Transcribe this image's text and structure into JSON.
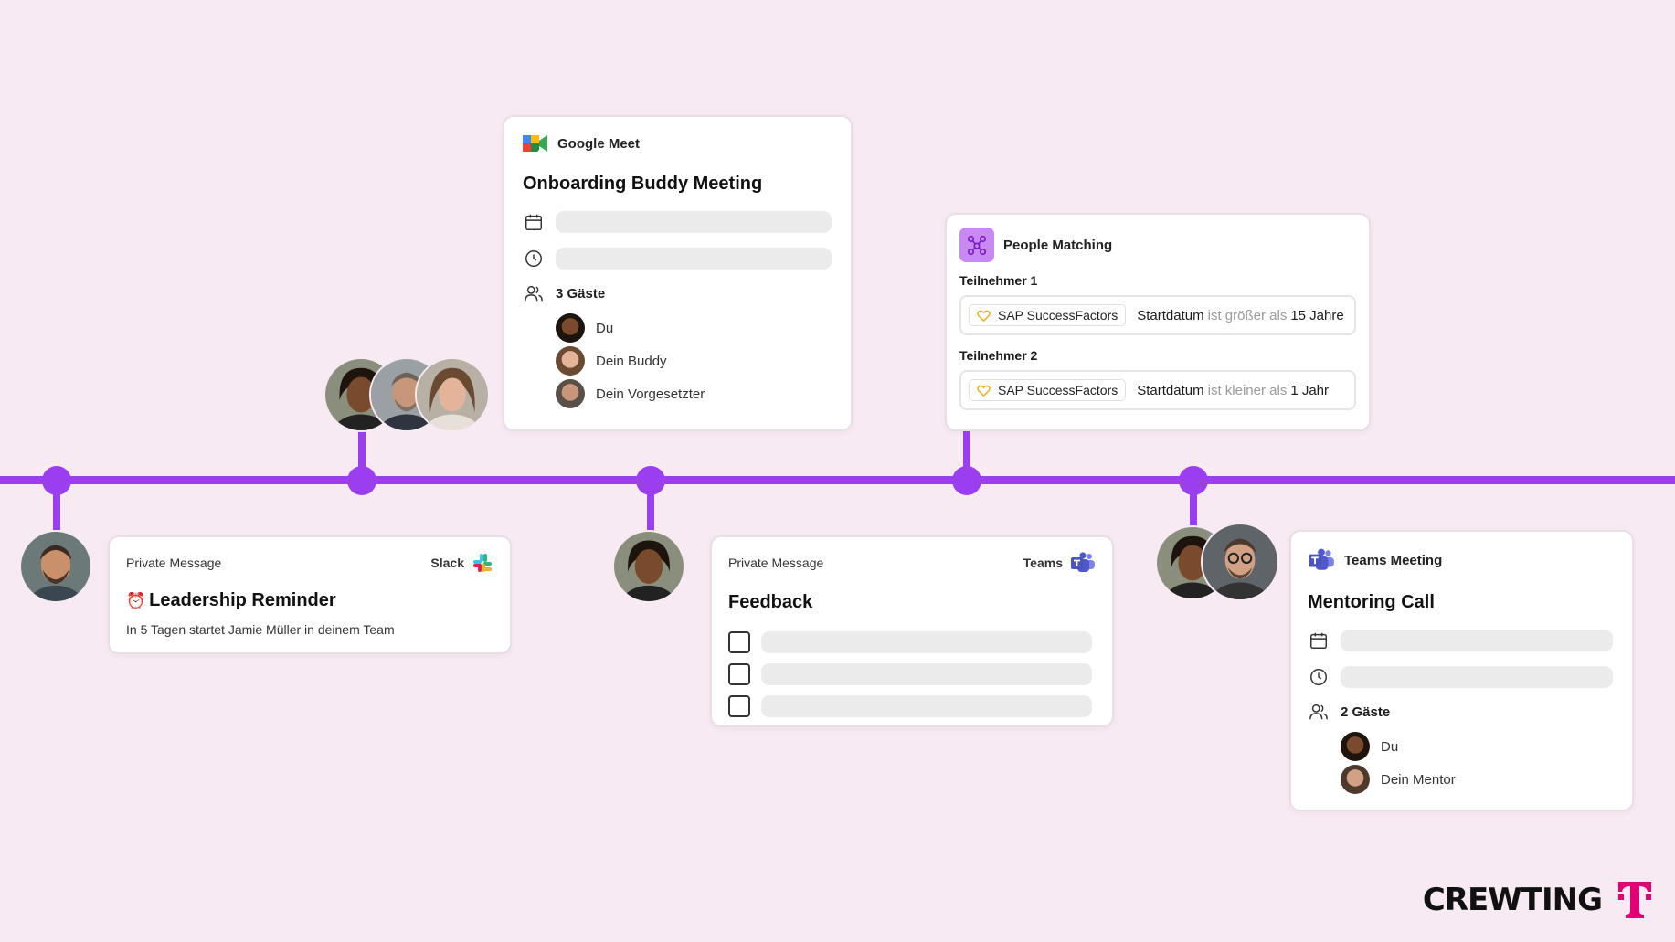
{
  "colors": {
    "background": "#f7eaf2",
    "timeline": "#9b3ef0",
    "telekom_magenta": "#e20074"
  },
  "google_meet_card": {
    "app": "Google Meet",
    "app_icon": "google-meet-icon",
    "title": "Onboarding Buddy Meeting",
    "guests_label": "3 Gäste",
    "guests": [
      "Du",
      "Dein Buddy",
      "Dein Vorgesetzter"
    ]
  },
  "people_matching_card": {
    "app": "People Matching",
    "app_icon": "network-icon",
    "participants": [
      {
        "label": "Teilnehmer 1",
        "source": "SAP SuccessFactors",
        "field": "Startdatum",
        "operator": "ist größer als",
        "value": "15 Jahre"
      },
      {
        "label": "Teilnehmer 2",
        "source": "SAP SuccessFactors",
        "field": "Startdatum",
        "operator": "ist kleiner als",
        "value": "1 Jahr"
      }
    ]
  },
  "slack_card": {
    "type_label": "Private Message",
    "app": "Slack",
    "app_icon": "slack-icon",
    "emoji": "⏰",
    "title": "Leadership Reminder",
    "body": "In 5 Tagen startet Jamie Müller in deinem Team"
  },
  "teams_feedback_card": {
    "type_label": "Private Message",
    "app": "Teams",
    "app_icon": "teams-icon",
    "title": "Feedback"
  },
  "teams_meeting_card": {
    "app": "Teams Meeting",
    "app_icon": "teams-icon",
    "title": "Mentoring Call",
    "guests_label": "2 Gäste",
    "guests": [
      "Du",
      "Dein Mentor"
    ]
  },
  "brand": {
    "wordmark": "CREWTING",
    "logo": "telekom-t-logo"
  }
}
